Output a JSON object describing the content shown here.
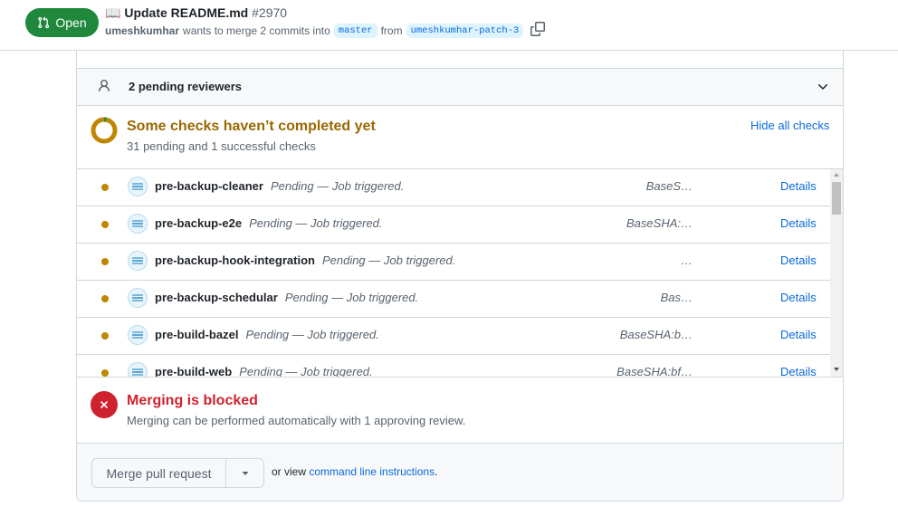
{
  "pr": {
    "state": "Open",
    "title": "Update README.md",
    "number": "#2970",
    "author": "umeshkumhar",
    "merge_text": "wants to merge 2 commits into",
    "base_branch": "master",
    "from_text": "from",
    "head_branch": "umeshkumhar-patch-3"
  },
  "reviewers": {
    "label": "2 pending reviewers"
  },
  "checks": {
    "title": "Some checks haven’t completed yet",
    "subtitle": "31 pending and 1 successful checks",
    "hide_label": "Hide all checks",
    "details_label": "Details",
    "status_color": "#bf8700",
    "rows": [
      {
        "name": "pre-backup-cleaner",
        "status": "Pending — Job triggered.",
        "sha": "BaseS…"
      },
      {
        "name": "pre-backup-e2e",
        "status": "Pending — Job triggered.",
        "sha": "BaseSHA:…"
      },
      {
        "name": "pre-backup-hook-integration",
        "status": "Pending — Job triggered.",
        "sha": "…"
      },
      {
        "name": "pre-backup-schedular",
        "status": "Pending — Job triggered.",
        "sha": "Bas…"
      },
      {
        "name": "pre-build-bazel",
        "status": "Pending — Job triggered.",
        "sha": "BaseSHA:b…"
      },
      {
        "name": "pre-build-web",
        "status": "Pending — Job triggered.",
        "sha": "BaseSHA:bf…"
      }
    ]
  },
  "merge_status": {
    "title": "Merging is blocked",
    "subtitle": "Merging can be performed automatically with 1 approving review.",
    "color": "#cf222e"
  },
  "merge_bar": {
    "button_label": "Merge pull request",
    "or_view_text": "or view",
    "cli_link": "command line instructions",
    "period": "."
  },
  "icons": {
    "open": "git-pull-request-icon",
    "title_emoji": "📖",
    "copy": "copy-icon",
    "reviewer": "person-icon",
    "expand": "chevron-down-icon",
    "checks": "pending-donut-icon",
    "blocked": "x-circle-icon",
    "merge_caret": "triangle-down-icon"
  }
}
